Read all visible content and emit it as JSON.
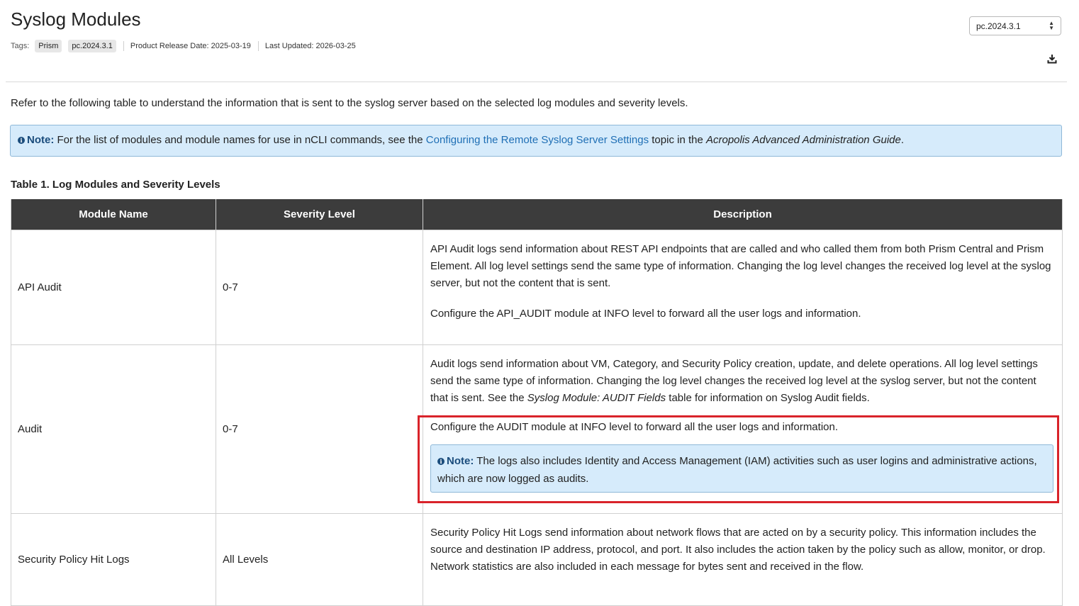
{
  "page": {
    "title": "Syslog Modules",
    "tags_label": "Tags:",
    "tags": [
      "Prism",
      "pc.2024.3.1"
    ],
    "release_date": "Product Release Date: 2025-03-19",
    "last_updated": "Last Updated: 2026-03-25",
    "version_selected": "pc.2024.3.1",
    "intro": "Refer to the following table to understand the information that is sent to the syslog server based on the selected log modules and severity levels."
  },
  "note": {
    "label": "Note:",
    "text_before": " For the list of modules and module names for use in nCLI commands, see the ",
    "link": "Configuring the Remote Syslog Server Settings",
    "text_middle": " topic in the ",
    "guide": "Acropolis Advanced Administration Guide",
    "text_after": "."
  },
  "table": {
    "caption": "Table 1. Log Modules and Severity Levels",
    "headers": [
      "Module Name",
      "Severity Level",
      "Description"
    ],
    "rows": [
      {
        "module": "API Audit",
        "severity": "0-7",
        "desc1": "API Audit logs send information about REST API endpoints that are called and who called them from both Prism Central and Prism Element. All log level settings send the same type of information. Changing the log level changes the received log level at the syslog server, but not the content that is sent.",
        "desc2": "Configure the API_AUDIT module at INFO level to forward all the user logs and information."
      },
      {
        "module": "Audit",
        "severity": "0-7",
        "desc1_before": "Audit logs send information about VM, Category, and Security Policy creation, update, and delete operations. All log level settings send the same type of information. Changing the log level changes the received log level at the syslog server, but not the content that is sent. See the ",
        "desc1_italic": "Syslog Module: AUDIT Fields",
        "desc1_after": " table for information on Syslog Audit fields.",
        "desc2": "Configure the AUDIT module at INFO level to forward all the user logs and information.",
        "note_label": "Note:",
        "note_text": " The logs also includes Identity and Access Management (IAM) activities such as user logins and administrative actions, which are now logged as audits."
      },
      {
        "module": "Security Policy Hit Logs",
        "severity": "All Levels",
        "desc1": "Security Policy Hit Logs send information about network flows that are acted on by a security policy. This information includes the source and destination IP address, protocol, and port. It also includes the action taken by the policy such as allow, monitor, or drop. Network statistics are also included in each message for bytes sent and received in the flow."
      }
    ]
  }
}
